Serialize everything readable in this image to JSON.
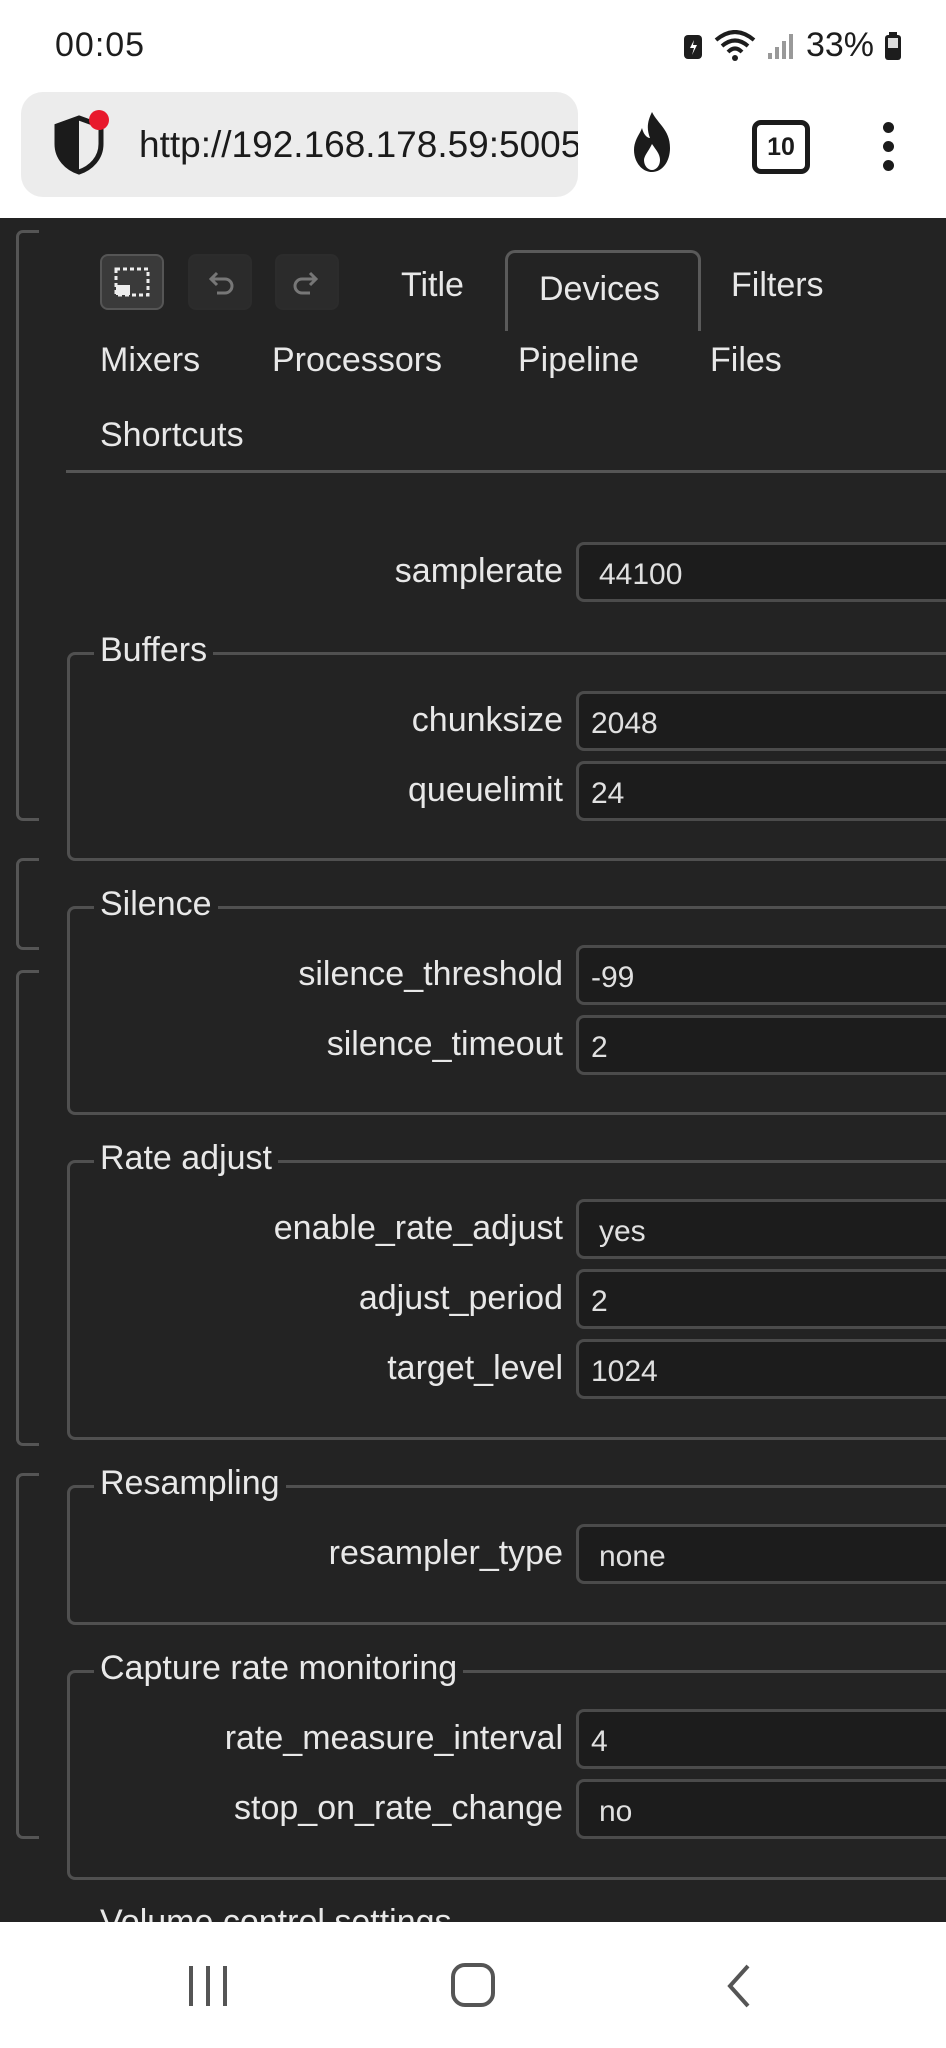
{
  "status_bar": {
    "time": "00:05",
    "battery": "33%"
  },
  "browser": {
    "url": "http://192.168.178.59:5005",
    "tab_count": "10"
  },
  "tabs": [
    "Title",
    "Devices",
    "Filters",
    "Mixers",
    "Processors",
    "Pipeline",
    "Files",
    "Shortcuts"
  ],
  "active_tab": "Devices",
  "fields": {
    "samplerate": {
      "label": "samplerate",
      "value": "44100"
    }
  },
  "groups": {
    "buffers": {
      "title": "Buffers",
      "chunksize": {
        "label": "chunksize",
        "value": "2048"
      },
      "queuelimit": {
        "label": "queuelimit",
        "value": "24"
      }
    },
    "silence": {
      "title": "Silence",
      "silence_threshold": {
        "label": "silence_threshold",
        "value": "-99"
      },
      "silence_timeout": {
        "label": "silence_timeout",
        "value": "2"
      }
    },
    "rate_adjust": {
      "title": "Rate adjust",
      "enable_rate_adjust": {
        "label": "enable_rate_adjust",
        "value": "yes"
      },
      "adjust_period": {
        "label": "adjust_period",
        "value": "2"
      },
      "target_level": {
        "label": "target_level",
        "value": "1024"
      }
    },
    "resampling": {
      "title": "Resampling",
      "resampler_type": {
        "label": "resampler_type",
        "value": "none"
      }
    },
    "capture_rate": {
      "title": "Capture rate monitoring",
      "rate_measure_interval": {
        "label": "rate_measure_interval",
        "value": "4"
      },
      "stop_on_rate_change": {
        "label": "stop_on_rate_change",
        "value": "no"
      }
    },
    "volume": {
      "title": "Volume control settings"
    }
  },
  "icons": {
    "toolbar": [
      "selection-icon",
      "undo-icon",
      "redo-icon"
    ],
    "browser": [
      "shield-icon",
      "fire-icon",
      "tabs-icon",
      "more-vert-icon"
    ],
    "nav": [
      "recents-icon",
      "home-icon",
      "back-icon"
    ]
  },
  "colors": {
    "background": "#232323",
    "text": "#e8e8e8",
    "border": "#505050",
    "privacy_dot": "#e8192c"
  }
}
